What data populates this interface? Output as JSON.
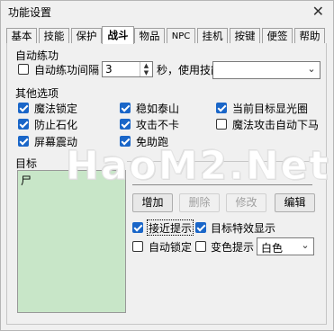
{
  "window": {
    "title": "功能设置",
    "close_glyph": "✕"
  },
  "tabs": [
    "基本",
    "技能",
    "保护",
    "战斗",
    "物品",
    "NPC",
    "挂机",
    "按键",
    "便签",
    "帮助"
  ],
  "active_tab": "战斗",
  "auto_practice": {
    "section_title": "自动练功",
    "interval_label": "自动练功间隔",
    "interval_checked": false,
    "interval_value": "3",
    "seconds_label": "秒，使用技能",
    "skill_value": ""
  },
  "other_options": {
    "section_title": "其他选项",
    "items": [
      {
        "label": "魔法锁定",
        "checked": true
      },
      {
        "label": "防止石化",
        "checked": true
      },
      {
        "label": "屏幕震动",
        "checked": true
      },
      {
        "label": "稳如泰山",
        "checked": true
      },
      {
        "label": "攻击不卡",
        "checked": true
      },
      {
        "label": "免助跑",
        "checked": true
      },
      {
        "label": "当前目标显光圈",
        "checked": true
      },
      {
        "label": "魔法攻击自动下马",
        "checked": false
      }
    ]
  },
  "target": {
    "section_title": "目标",
    "list_items": [
      "尸"
    ],
    "buttons": {
      "add": "增加",
      "delete": "删除",
      "modify": "修改",
      "edit": "编辑"
    },
    "approach_hint": {
      "label": "接近提示",
      "checked": true
    },
    "target_effect": {
      "label": "目标特效显示",
      "checked": true
    },
    "auto_lock": {
      "label": "自动锁定",
      "checked": false
    },
    "color_hint": {
      "label": "变色提示",
      "checked": false
    },
    "color_value": "白色"
  },
  "watermark": "HaoM2.Net"
}
